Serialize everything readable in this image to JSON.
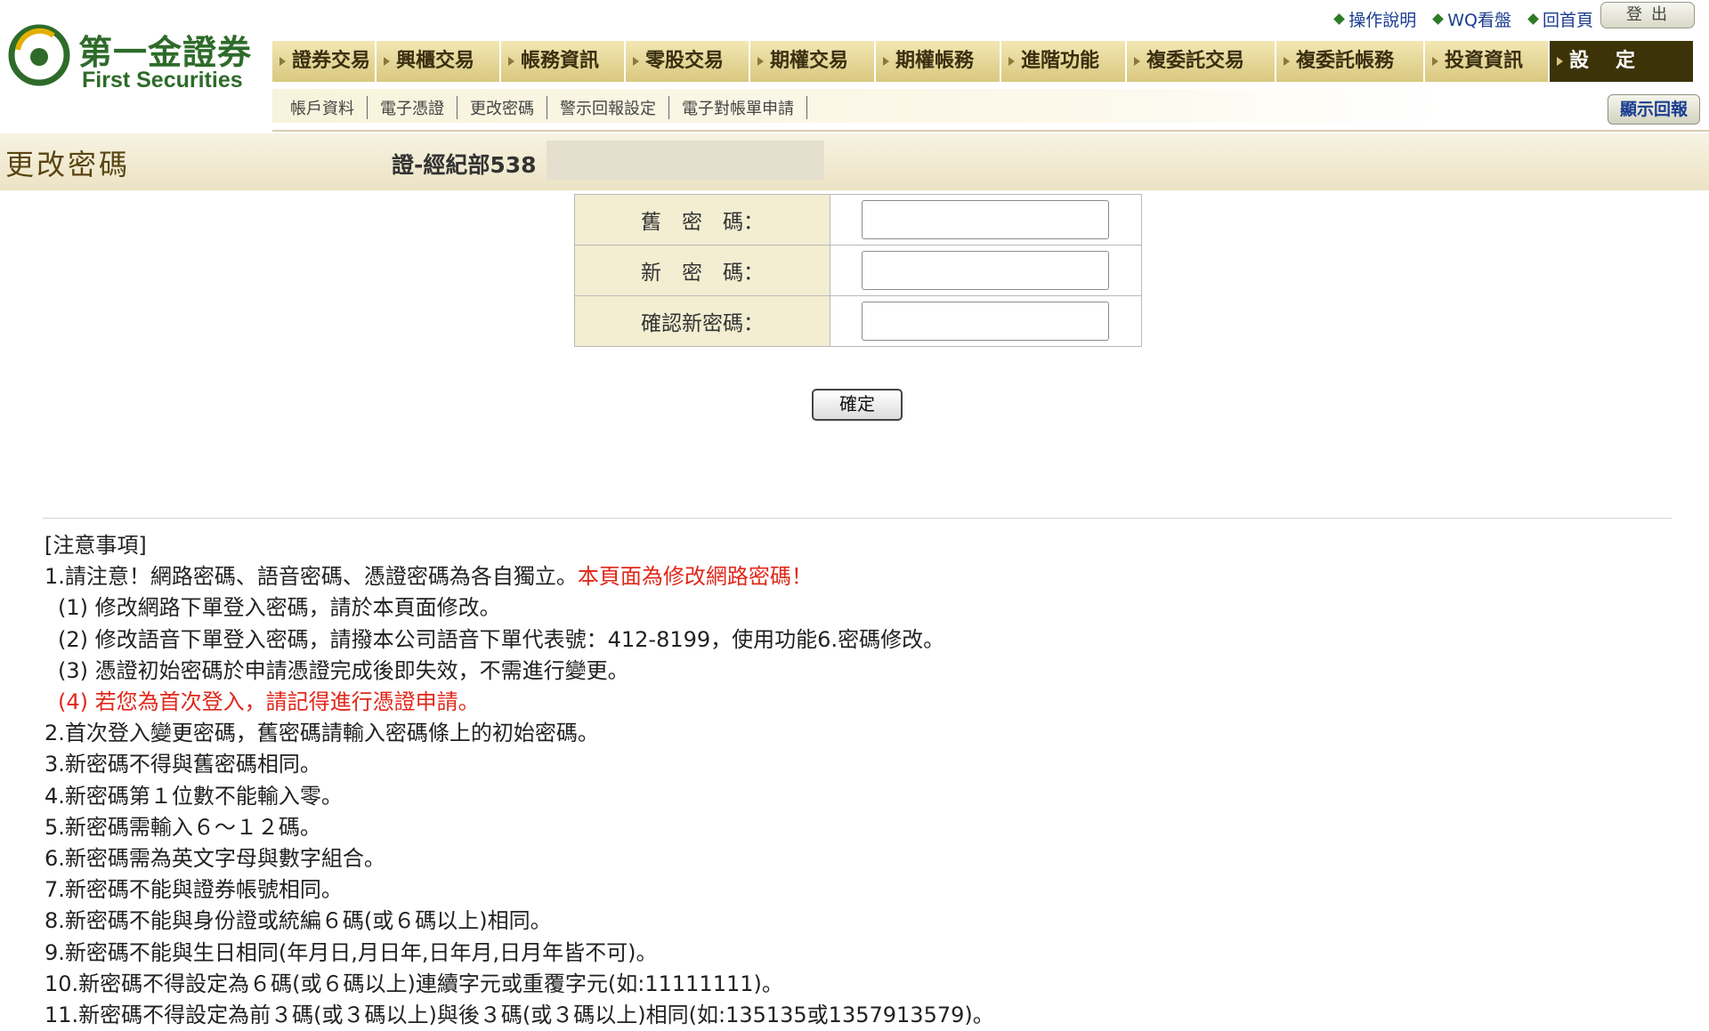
{
  "brand": {
    "name_cn": "第一金證券",
    "name_en": "First Securities",
    "primary_color": "#2e6b2a"
  },
  "top_links": [
    {
      "label": "操作說明",
      "icon": "diamond-bullet-icon"
    },
    {
      "label": "WQ看盤",
      "icon": "diamond-bullet-icon"
    },
    {
      "label": "回首頁",
      "icon": "diamond-bullet-icon"
    }
  ],
  "logout_label": "登出",
  "main_nav": [
    {
      "label": "證券交易"
    },
    {
      "label": "興櫃交易"
    },
    {
      "label": "帳務資訊"
    },
    {
      "label": "零股交易"
    },
    {
      "label": "期權交易"
    },
    {
      "label": "期權帳務"
    },
    {
      "label": "進階功能"
    },
    {
      "label": "複委託交易"
    },
    {
      "label": "複委託帳務"
    },
    {
      "label": "投資資訊"
    },
    {
      "label": "設定",
      "active": true
    }
  ],
  "sub_nav": [
    {
      "label": "帳戶資料"
    },
    {
      "label": "電子憑證"
    },
    {
      "label": "更改密碼"
    },
    {
      "label": "警示回報設定"
    },
    {
      "label": "電子對帳單申請"
    }
  ],
  "show_report_label": "顯示回報",
  "page": {
    "title": "更改密碼",
    "account_label": "證-經紀部538"
  },
  "form": {
    "old_password_label": "舊　密　碼：",
    "new_password_label": "新　密　碼：",
    "confirm_password_label": "確認新密碼：",
    "old_password_value": "",
    "new_password_value": "",
    "confirm_password_value": "",
    "submit_label": "確定"
  },
  "notes": {
    "heading": "[注意事項]",
    "item1_text": "1.請注意！網路密碼、語音密碼、憑證密碼為各自獨立。",
    "item1_highlight": "本頁面為修改網路密碼！",
    "item1_sub1": "(1) 修改網路下單登入密碼，請於本頁面修改。",
    "item1_sub2": "(2) 修改語音下單登入密碼，請撥本公司語音下單代表號：412-8199，使用功能6.密碼修改。",
    "item1_sub3": "(3) 憑證初始密碼於申請憑證完成後即失效，不需進行變更。",
    "item1_sub4": "(4) 若您為首次登入，請記得進行憑證申請。",
    "item2": "2.首次登入變更密碼，舊密碼請輸入密碼條上的初始密碼。",
    "item3": "3.新密碼不得與舊密碼相同。",
    "item4": "4.新密碼第１位數不能輸入零。",
    "item5": "5.新密碼需輸入６～１２碼。",
    "item6": "6.新密碼需為英文字母與數字組合。",
    "item7": "7.新密碼不能與證券帳號相同。",
    "item8": "8.新密碼不能與身份證或統編６碼(或６碼以上)相同。",
    "item9": "9.新密碼不能與生日相同(年月日,月日年,日年月,日月年皆不可)。",
    "item10": "10.新密碼不得設定為６碼(或６碼以上)連續字元或重覆字元(如:11111111)。",
    "item11": "11.新密碼不得設定為前３碼(或３碼以上)與後３碼(或３碼以上)相同(如:135135或1357913579)。",
    "highlight_color": "#e0271a"
  }
}
